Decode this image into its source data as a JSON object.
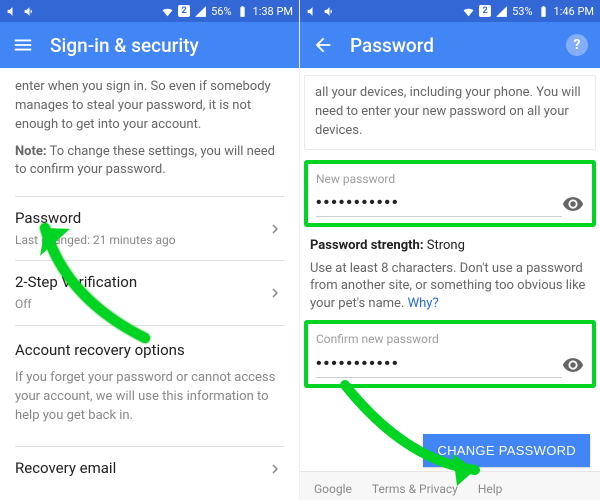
{
  "left": {
    "statusbar": {
      "sim": "2",
      "battery": "56%",
      "time": "1:38 PM"
    },
    "appbar": {
      "title": "Sign-in & security"
    },
    "intro_text": "enter when you sign in. So even if somebody manages to steal your password, it is not enough to get into your account.",
    "note_label": "Note:",
    "note_text": " To change these settings, you will need to confirm your password.",
    "items": [
      {
        "title": "Password",
        "subtitle": "Last changed: 21 minutes ago"
      },
      {
        "title": "2-Step Verification",
        "subtitle": "Off"
      }
    ],
    "recovery_heading": "Account recovery options",
    "recovery_text": "If you forget your password or cannot access your account, we will use this information to help you get back in.",
    "bottom_peek": "Recovery email"
  },
  "right": {
    "statusbar": {
      "sim": "2",
      "battery": "53%",
      "time": "1:46 PM"
    },
    "appbar": {
      "title": "Password"
    },
    "info_text": "all your devices, including your phone. You will need to enter your new password on all your devices.",
    "new_label": "New password",
    "new_value": "•••••••••••",
    "strength_label": "Password strength:",
    "strength_value": "Strong",
    "hint_text": "Use at least 8 characters. Don't use a password from another site, or something too obvious like your pet's name. ",
    "why_link": "Why?",
    "confirm_label": "Confirm new password",
    "confirm_value": "•••••••••••",
    "change_button": "CHANGE PASSWORD",
    "footer": {
      "google": "Google",
      "terms": "Terms & Privacy",
      "help": "Help"
    }
  }
}
